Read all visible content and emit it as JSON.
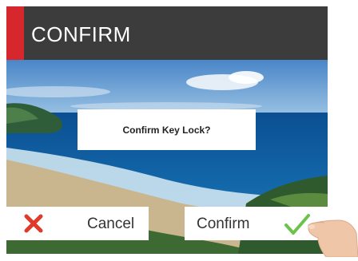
{
  "title": "CONFIRM",
  "dialog": {
    "message": "Confirm Key Lock?"
  },
  "buttons": {
    "cancel": "Cancel",
    "confirm": "Confirm"
  },
  "icons": {
    "cancel": "x-icon",
    "confirm": "checkmark-icon"
  },
  "colors": {
    "accent": "#d6272c",
    "titlebar": "#3c3c3c",
    "cancel_icon": "#e03a2b",
    "confirm_icon": "#6cc24a"
  }
}
